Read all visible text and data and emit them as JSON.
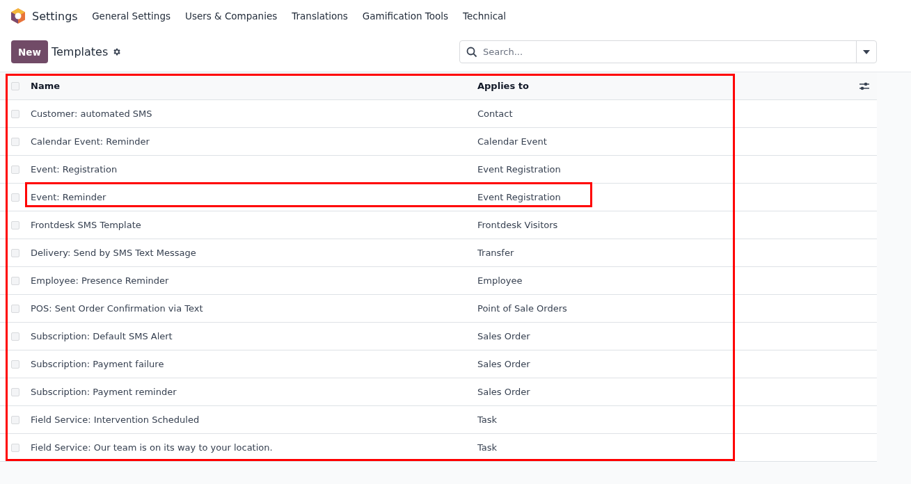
{
  "navbar": {
    "app": "Settings",
    "menu": [
      "General Settings",
      "Users & Companies",
      "Translations",
      "Gamification Tools",
      "Technical"
    ]
  },
  "control_panel": {
    "new_button": "New",
    "title": "Templates"
  },
  "search": {
    "placeholder": "Search..."
  },
  "table": {
    "annotated": true,
    "all_checked": false,
    "columns": [
      "Name",
      "Applies to"
    ],
    "rows": [
      {
        "name": "Customer: automated SMS",
        "applies_to": "Contact",
        "checked": false,
        "highlighted": false
      },
      {
        "name": "Calendar Event: Reminder",
        "applies_to": "Calendar Event",
        "checked": false,
        "highlighted": false
      },
      {
        "name": "Event: Registration",
        "applies_to": "Event Registration",
        "checked": false,
        "highlighted": false
      },
      {
        "name": "Event: Reminder",
        "applies_to": "Event Registration",
        "checked": false,
        "highlighted": true
      },
      {
        "name": "Frontdesk SMS Template",
        "applies_to": "Frontdesk Visitors",
        "checked": false,
        "highlighted": false
      },
      {
        "name": "Delivery: Send by SMS Text Message",
        "applies_to": "Transfer",
        "checked": false,
        "highlighted": false
      },
      {
        "name": "Employee: Presence Reminder",
        "applies_to": "Employee",
        "checked": false,
        "highlighted": false
      },
      {
        "name": "POS: Sent Order Confirmation via Text",
        "applies_to": "Point of Sale Orders",
        "checked": false,
        "highlighted": false
      },
      {
        "name": "Subscription: Default SMS Alert",
        "applies_to": "Sales Order",
        "checked": false,
        "highlighted": false
      },
      {
        "name": "Subscription: Payment failure",
        "applies_to": "Sales Order",
        "checked": false,
        "highlighted": false
      },
      {
        "name": "Subscription: Payment reminder",
        "applies_to": "Sales Order",
        "checked": false,
        "highlighted": false
      },
      {
        "name": "Field Service: Intervention Scheduled",
        "applies_to": "Task",
        "checked": false,
        "highlighted": false
      },
      {
        "name": "Field Service: Our team is on its way to your location.",
        "applies_to": "Task",
        "checked": false,
        "highlighted": false
      }
    ]
  }
}
